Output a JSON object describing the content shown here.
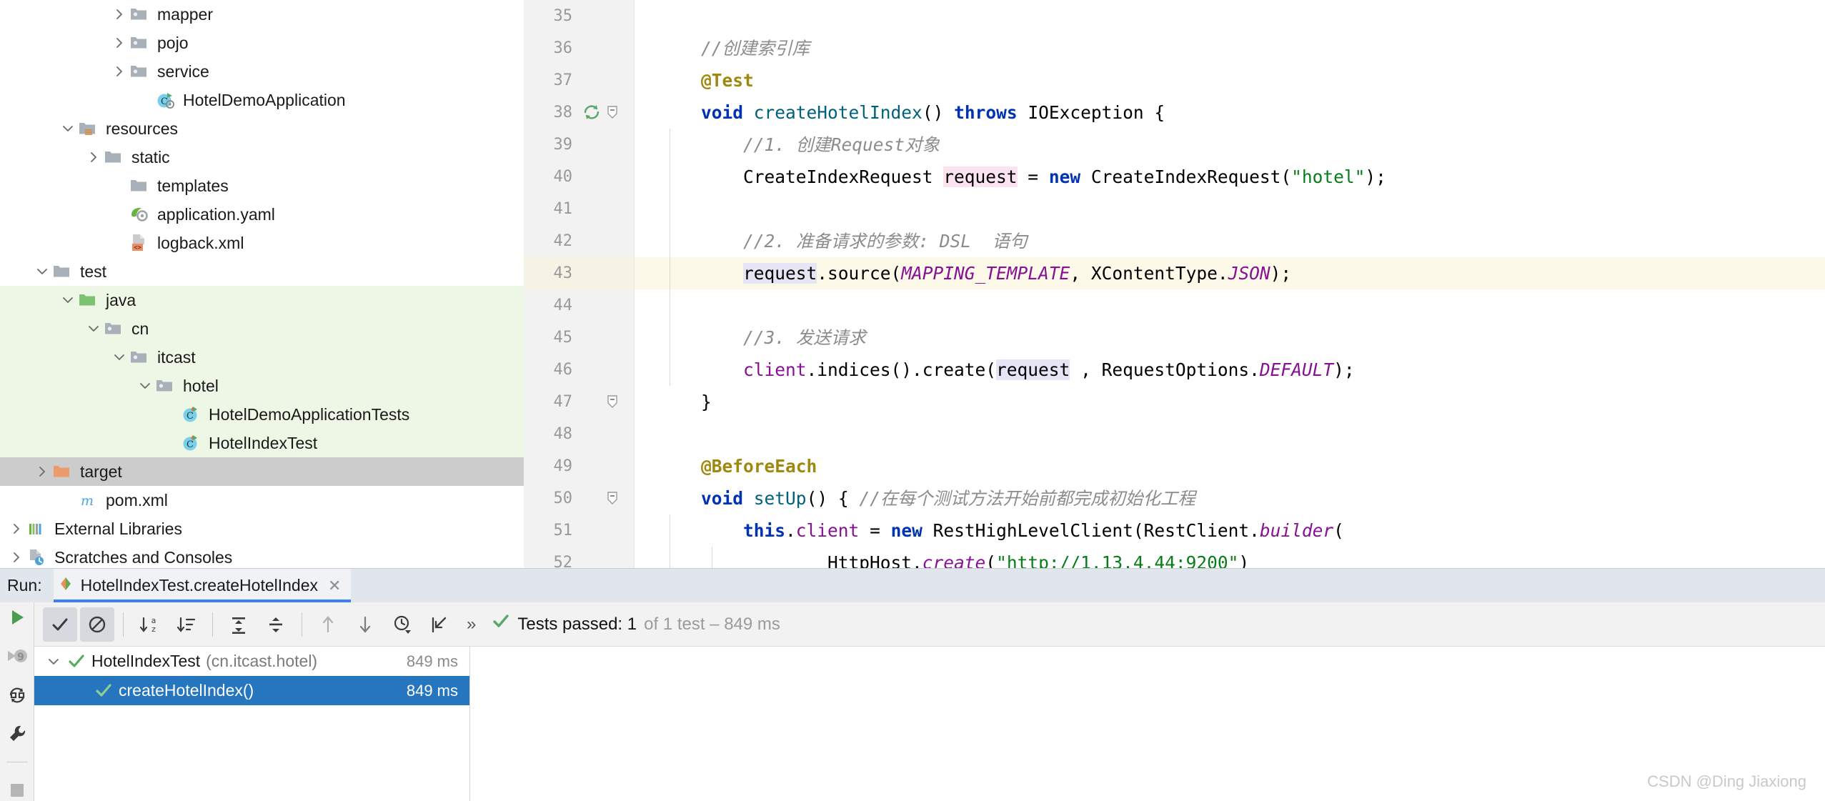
{
  "project_tree": {
    "items": [
      {
        "label": "mapper",
        "icon": "folder-package-icon",
        "arrow": "right",
        "indent": 4,
        "state": "normal"
      },
      {
        "label": "pojo",
        "icon": "folder-package-icon",
        "arrow": "right",
        "indent": 4,
        "state": "normal"
      },
      {
        "label": "service",
        "icon": "folder-package-icon",
        "arrow": "right",
        "indent": 4,
        "state": "normal"
      },
      {
        "label": "HotelDemoApplication",
        "icon": "java-class-run-icon",
        "arrow": "none",
        "indent": 5,
        "state": "normal"
      },
      {
        "label": "resources",
        "icon": "folder-resources-icon",
        "arrow": "down",
        "indent": 2,
        "state": "normal"
      },
      {
        "label": "static",
        "icon": "folder-icon",
        "arrow": "right",
        "indent": 3,
        "state": "normal"
      },
      {
        "label": "templates",
        "icon": "folder-icon",
        "arrow": "none",
        "indent": 4,
        "state": "normal"
      },
      {
        "label": "application.yaml",
        "icon": "spring-yaml-icon",
        "arrow": "none",
        "indent": 4,
        "state": "normal"
      },
      {
        "label": "logback.xml",
        "icon": "xml-file-icon",
        "arrow": "none",
        "indent": 4,
        "state": "normal"
      },
      {
        "label": "test",
        "icon": "folder-icon",
        "arrow": "down",
        "indent": 1,
        "state": "normal"
      },
      {
        "label": "java",
        "icon": "folder-source-test-icon",
        "arrow": "down",
        "indent": 2,
        "state": "green"
      },
      {
        "label": "cn",
        "icon": "folder-package-icon",
        "arrow": "down",
        "indent": 3,
        "state": "green"
      },
      {
        "label": "itcast",
        "icon": "folder-package-icon",
        "arrow": "down",
        "indent": 4,
        "state": "green"
      },
      {
        "label": "hotel",
        "icon": "folder-package-icon",
        "arrow": "down",
        "indent": 5,
        "state": "green"
      },
      {
        "label": "HotelDemoApplicationTests",
        "icon": "java-test-class-icon",
        "arrow": "none",
        "indent": 6,
        "state": "green"
      },
      {
        "label": "HotelIndexTest",
        "icon": "java-test-class-icon",
        "arrow": "none",
        "indent": 6,
        "state": "green"
      },
      {
        "label": "target",
        "icon": "folder-excluded-icon",
        "arrow": "right",
        "indent": 1,
        "state": "selected"
      },
      {
        "label": "pom.xml",
        "icon": "maven-pom-icon",
        "arrow": "none",
        "indent": 2,
        "state": "normal"
      },
      {
        "label": "External Libraries",
        "icon": "libraries-icon",
        "arrow": "right",
        "indent": 0,
        "state": "normal"
      },
      {
        "label": "Scratches and Consoles",
        "icon": "scratches-icon",
        "arrow": "right",
        "indent": 0,
        "state": "normal"
      }
    ]
  },
  "editor": {
    "lines": [
      {
        "num": "35",
        "current": false,
        "gutter_run": false,
        "gutter_fold": false,
        "indent_guides": 0,
        "tokens": []
      },
      {
        "num": "36",
        "current": false,
        "gutter_run": false,
        "gutter_fold": false,
        "indent_guides": 0,
        "tokens": [
          {
            "t": "    ",
            "c": "plain"
          },
          {
            "t": "//创建索引库",
            "c": "cmt"
          }
        ]
      },
      {
        "num": "37",
        "current": false,
        "gutter_run": false,
        "gutter_fold": false,
        "indent_guides": 0,
        "tokens": [
          {
            "t": "    ",
            "c": "plain"
          },
          {
            "t": "@Test",
            "c": "ann"
          }
        ]
      },
      {
        "num": "38",
        "current": false,
        "gutter_run": true,
        "gutter_fold": true,
        "indent_guides": 0,
        "tokens": [
          {
            "t": "    ",
            "c": "plain"
          },
          {
            "t": "void",
            "c": "k"
          },
          {
            "t": " ",
            "c": "plain"
          },
          {
            "t": "createHotelIndex",
            "c": "mth"
          },
          {
            "t": "() ",
            "c": "plain"
          },
          {
            "t": "throws",
            "c": "k"
          },
          {
            "t": " IOException {",
            "c": "plain"
          }
        ]
      },
      {
        "num": "39",
        "current": false,
        "gutter_run": false,
        "gutter_fold": false,
        "indent_guides": 1,
        "tokens": [
          {
            "t": "        ",
            "c": "plain"
          },
          {
            "t": "//1. 创建Request对象",
            "c": "cmt"
          }
        ]
      },
      {
        "num": "40",
        "current": false,
        "gutter_run": false,
        "gutter_fold": false,
        "indent_guides": 1,
        "tokens": [
          {
            "t": "        ",
            "c": "plain"
          },
          {
            "t": "CreateIndexRequest ",
            "c": "plain"
          },
          {
            "t": "request",
            "c": "plain hl-pink"
          },
          {
            "t": " = ",
            "c": "plain"
          },
          {
            "t": "new",
            "c": "k"
          },
          {
            "t": " CreateIndexRequest(",
            "c": "plain"
          },
          {
            "t": "\"hotel\"",
            "c": "str"
          },
          {
            "t": ");",
            "c": "plain"
          }
        ]
      },
      {
        "num": "41",
        "current": false,
        "gutter_run": false,
        "gutter_fold": false,
        "indent_guides": 1,
        "tokens": []
      },
      {
        "num": "42",
        "current": false,
        "gutter_run": false,
        "gutter_fold": false,
        "indent_guides": 1,
        "tokens": [
          {
            "t": "        ",
            "c": "plain"
          },
          {
            "t": "//2. 准备请求的参数: DSL  语句",
            "c": "cmt"
          }
        ]
      },
      {
        "num": "43",
        "current": true,
        "gutter_run": false,
        "gutter_fold": false,
        "indent_guides": 1,
        "tokens": [
          {
            "t": "        ",
            "c": "plain"
          },
          {
            "t": "request",
            "c": "plain hl-lav"
          },
          {
            "t": ".source(",
            "c": "plain"
          },
          {
            "t": "MAPPING_TEMPLATE",
            "c": "stc"
          },
          {
            "t": ", XContentType.",
            "c": "plain"
          },
          {
            "t": "JSON",
            "c": "stc"
          },
          {
            "t": ");",
            "c": "plain"
          }
        ]
      },
      {
        "num": "44",
        "current": false,
        "gutter_run": false,
        "gutter_fold": false,
        "indent_guides": 1,
        "tokens": []
      },
      {
        "num": "45",
        "current": false,
        "gutter_run": false,
        "gutter_fold": false,
        "indent_guides": 1,
        "tokens": [
          {
            "t": "        ",
            "c": "plain"
          },
          {
            "t": "//3. 发送请求",
            "c": "cmt"
          }
        ]
      },
      {
        "num": "46",
        "current": false,
        "gutter_run": false,
        "gutter_fold": false,
        "indent_guides": 1,
        "tokens": [
          {
            "t": "        ",
            "c": "plain"
          },
          {
            "t": "client",
            "c": "fld"
          },
          {
            "t": ".indices().create(",
            "c": "plain"
          },
          {
            "t": "request",
            "c": "plain hl-lav"
          },
          {
            "t": " , RequestOptions.",
            "c": "plain"
          },
          {
            "t": "DEFAULT",
            "c": "stc"
          },
          {
            "t": ");",
            "c": "plain"
          }
        ]
      },
      {
        "num": "47",
        "current": false,
        "gutter_run": false,
        "gutter_fold": true,
        "indent_guides": 0,
        "tokens": [
          {
            "t": "    }",
            "c": "plain"
          }
        ]
      },
      {
        "num": "48",
        "current": false,
        "gutter_run": false,
        "gutter_fold": false,
        "indent_guides": 0,
        "tokens": []
      },
      {
        "num": "49",
        "current": false,
        "gutter_run": false,
        "gutter_fold": false,
        "indent_guides": 0,
        "tokens": [
          {
            "t": "    ",
            "c": "plain"
          },
          {
            "t": "@BeforeEach",
            "c": "ann"
          }
        ]
      },
      {
        "num": "50",
        "current": false,
        "gutter_run": false,
        "gutter_fold": true,
        "indent_guides": 0,
        "tokens": [
          {
            "t": "    ",
            "c": "plain"
          },
          {
            "t": "void",
            "c": "k"
          },
          {
            "t": " ",
            "c": "plain"
          },
          {
            "t": "setUp",
            "c": "mth"
          },
          {
            "t": "() { ",
            "c": "plain"
          },
          {
            "t": "//在每个测试方法开始前都完成初始化工程",
            "c": "cmt"
          }
        ]
      },
      {
        "num": "51",
        "current": false,
        "gutter_run": false,
        "gutter_fold": false,
        "indent_guides": 1,
        "tokens": [
          {
            "t": "        ",
            "c": "plain"
          },
          {
            "t": "this",
            "c": "k"
          },
          {
            "t": ".",
            "c": "plain"
          },
          {
            "t": "client",
            "c": "fld"
          },
          {
            "t": " = ",
            "c": "plain"
          },
          {
            "t": "new",
            "c": "k"
          },
          {
            "t": " RestHighLevelClient(RestClient.",
            "c": "plain"
          },
          {
            "t": "builder",
            "c": "stc"
          },
          {
            "t": "(",
            "c": "plain"
          }
        ]
      },
      {
        "num": "52",
        "current": false,
        "gutter_run": false,
        "gutter_fold": false,
        "indent_guides": 2,
        "tokens": [
          {
            "t": "                ",
            "c": "plain"
          },
          {
            "t": "HttpHost.",
            "c": "plain"
          },
          {
            "t": "create",
            "c": "stc"
          },
          {
            "t": "(",
            "c": "plain"
          },
          {
            "t": "\"",
            "c": "str"
          },
          {
            "t": "http://1.13.4.44:9200",
            "c": "str url-u"
          },
          {
            "t": "\"",
            "c": "str"
          },
          {
            "t": ")",
            "c": "plain"
          }
        ]
      }
    ]
  },
  "run_panel": {
    "label": "Run:",
    "tab": {
      "title": "HotelIndexTest.createHotelIndex",
      "close": "✕",
      "icon": "test-config-icon"
    },
    "sidebar_buttons": [
      {
        "name": "rerun-button",
        "icon": "play-green-icon"
      },
      {
        "name": "rerun-failed-tests-button",
        "icon": "rerun-failed-icon"
      },
      {
        "name": "toggle-auto-test-button",
        "icon": "auto-test-icon"
      },
      {
        "name": "settings-button",
        "icon": "wrench-icon"
      },
      {
        "name": "stop-button",
        "icon": "stop-square-icon"
      }
    ],
    "toolbar": [
      {
        "name": "show-passed-button",
        "icon": "checkmark-icon",
        "toggled": true
      },
      {
        "name": "hide-ignored-button",
        "icon": "ignored-circle-icon",
        "toggled": true
      },
      {
        "name": "sort-alphabetically-button",
        "icon": "sort-az-icon",
        "toggled": false
      },
      {
        "name": "sort-by-duration-button",
        "icon": "sort-duration-icon",
        "toggled": false
      },
      {
        "name": "expand-all-button",
        "icon": "expand-all-icon",
        "toggled": false
      },
      {
        "name": "collapse-all-button",
        "icon": "collapse-all-icon",
        "toggled": false
      },
      {
        "name": "previous-failed-button",
        "icon": "arrow-up-icon",
        "toggled": false
      },
      {
        "name": "next-failed-button",
        "icon": "arrow-down-icon",
        "toggled": false
      },
      {
        "name": "test-history-button",
        "icon": "clock-history-icon",
        "toggled": false
      },
      {
        "name": "import-tests-button",
        "icon": "import-tests-icon",
        "toggled": false
      }
    ],
    "overflow_chevron": "»",
    "status": {
      "icon": "green-check-icon",
      "primary": "Tests passed: 1",
      "secondary": "of 1 test – 849 ms"
    },
    "test_tree": [
      {
        "name": "HotelIndexTest",
        "package": "(cn.itcast.hotel)",
        "time": "849 ms",
        "arrow": "down",
        "selected": false,
        "indent": 0,
        "status_icon": "green-check-icon"
      },
      {
        "name": "createHotelIndex()",
        "package": "",
        "time": "849 ms",
        "arrow": "none",
        "selected": true,
        "indent": 1,
        "status_icon": "green-check-icon"
      }
    ]
  },
  "watermark": "CSDN @Ding Jiaxiong",
  "colors": {
    "tree_green_highlight": "#eef7e5",
    "tree_selected_gray": "#cccccc",
    "test_selected_blue": "#2675bf",
    "current_line_yellow": "#fdf9e8",
    "tab_underline_blue": "#3c80f6",
    "pass_green": "#59a869"
  }
}
